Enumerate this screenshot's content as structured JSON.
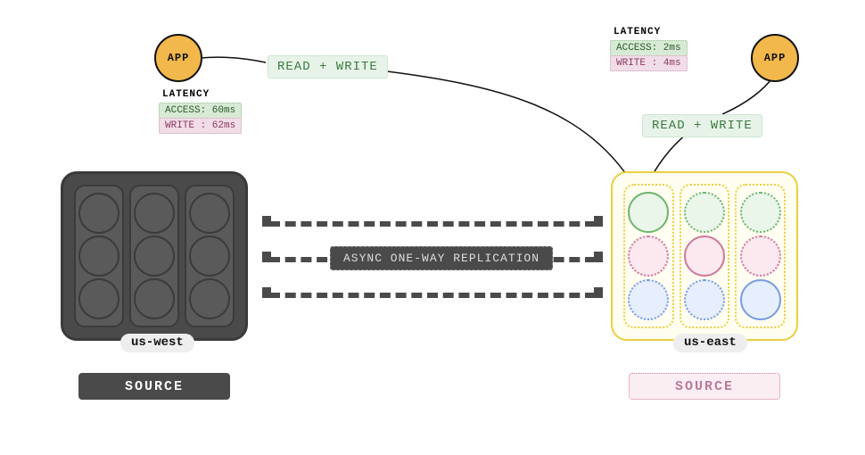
{
  "app_label": "APP",
  "latency_title": "LATENCY",
  "latency_west": {
    "access": "ACCESS: 60ms",
    "write": "WRITE : 62ms"
  },
  "latency_east": {
    "access": "ACCESS: 2ms",
    "write": "WRITE : 4ms"
  },
  "rw_label": "READ + WRITE",
  "replication_label": "ASYNC ONE-WAY REPLICATION",
  "region_west": "us-west",
  "region_east": "us-east",
  "source_label": "SOURCE"
}
